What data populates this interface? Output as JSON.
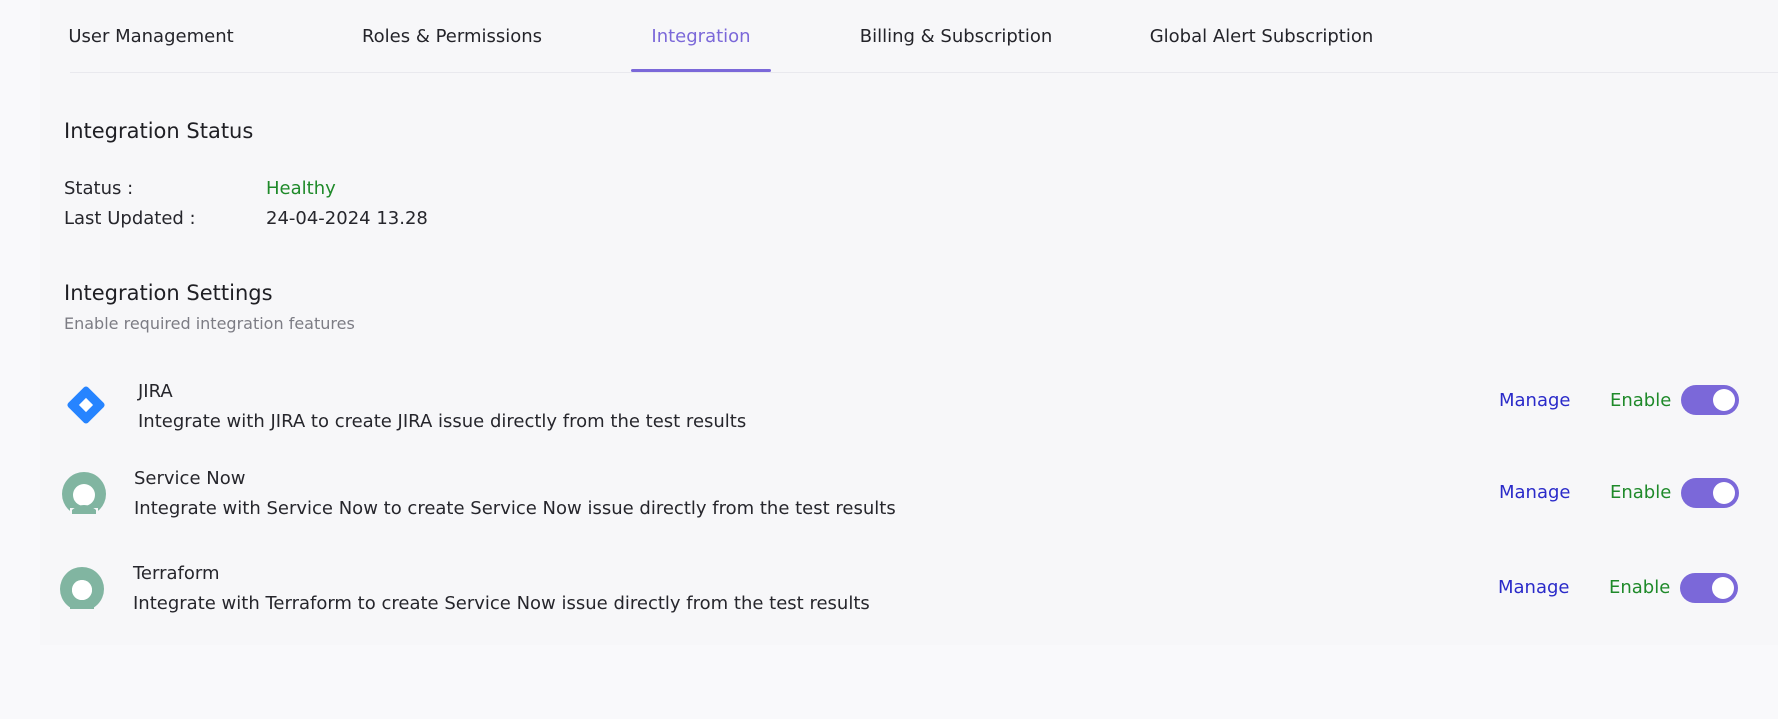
{
  "tabs": [
    {
      "label": "User Management",
      "active": false
    },
    {
      "label": "Roles & Permissions",
      "active": false
    },
    {
      "label": "Integration",
      "active": true
    },
    {
      "label": "Billing & Subscription",
      "active": false
    },
    {
      "label": "Global Alert Subscription",
      "active": false
    }
  ],
  "integration_status": {
    "title": "Integration Status",
    "status_label": "Status :",
    "status_value": "Healthy",
    "updated_label": "Last Updated :",
    "updated_value": "24-04-2024 13.28"
  },
  "integration_settings": {
    "title": "Integration Settings",
    "subtitle": "Enable required integration features",
    "items": [
      {
        "name": "JIRA",
        "description": "Integrate with JIRA to create JIRA issue directly from the test results",
        "icon": "jira-icon",
        "manage_label": "Manage",
        "enable_label": "Enable",
        "enabled": true
      },
      {
        "name": "Service Now",
        "description": "Integrate with Service Now to create Service Now issue directly from the test results",
        "icon": "servicenow-icon",
        "manage_label": "Manage",
        "enable_label": "Enable",
        "enabled": true
      },
      {
        "name": "Terraform",
        "description": "Integrate with Terraform to create Service Now issue directly from the test results",
        "icon": "servicenow-icon",
        "manage_label": "Manage",
        "enable_label": "Enable",
        "enabled": true
      }
    ]
  },
  "colors": {
    "accent": "#7b68d9",
    "healthy": "#1f8a2a",
    "link": "#2a2ac9",
    "jira_blue": "#2684ff",
    "servicenow_green": "#81b5a1"
  }
}
